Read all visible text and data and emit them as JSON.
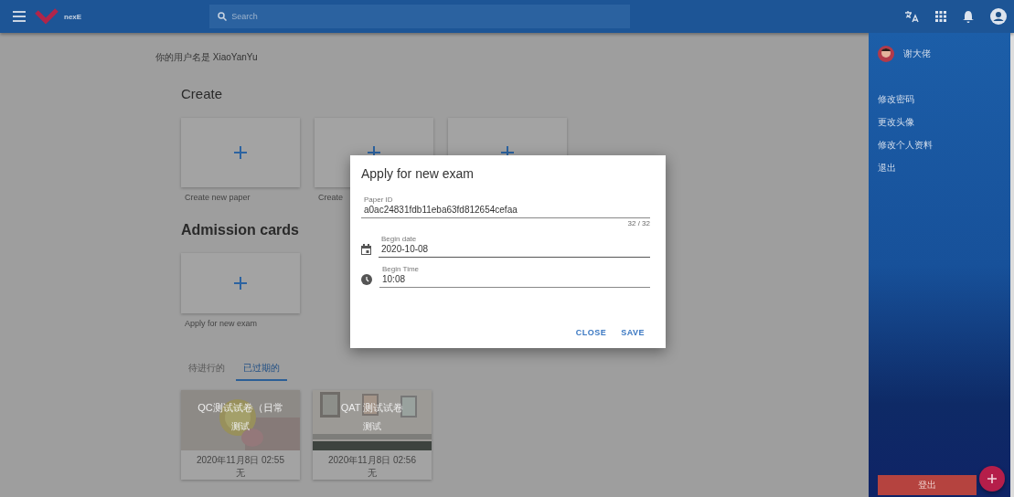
{
  "app_bar": {
    "logo_text": "nexE",
    "search_placeholder": "Search"
  },
  "greeting": "你的用户名是 XiaoYanYu",
  "create": {
    "title": "Create",
    "cards": [
      {
        "kind": "add",
        "label": "Create new paper"
      },
      {
        "kind": "add",
        "label": "Create"
      },
      {
        "kind": "add"
      }
    ]
  },
  "admission": {
    "title": "Admission cards",
    "cards": [
      {
        "kind": "add",
        "label": "Apply for new exam"
      }
    ]
  },
  "tabs": [
    {
      "label": "待进行的",
      "selected": false
    },
    {
      "label": "已过期的",
      "selected": true
    }
  ],
  "exam_cards": [
    {
      "title": "QC测试试卷（日常",
      "subtitle": "测试",
      "date": "2020年11月8日 02:55",
      "note": "无"
    },
    {
      "title": "QAT 测试试卷",
      "subtitle": "测试",
      "date": "2020年11月8日 02:56",
      "note": "无"
    }
  ],
  "drawer": {
    "user": "谢大佬",
    "items": [
      "修改密码",
      "更改头像",
      "修改个人资料",
      "退出"
    ],
    "logout": "登出"
  },
  "dialog": {
    "title": "Apply for new exam",
    "fields": [
      {
        "label": "Paper ID",
        "value": "a0ac24831fdb11eba63fd812654cefaa",
        "counter": "32 / 32",
        "kind": "text"
      },
      {
        "label": "Begin date",
        "value": "2020-10-08",
        "kind": "date"
      },
      {
        "label": "Begin Time",
        "value": "10:08",
        "kind": "time"
      }
    ],
    "buttons": [
      "CLOSE",
      "SAVE"
    ]
  }
}
